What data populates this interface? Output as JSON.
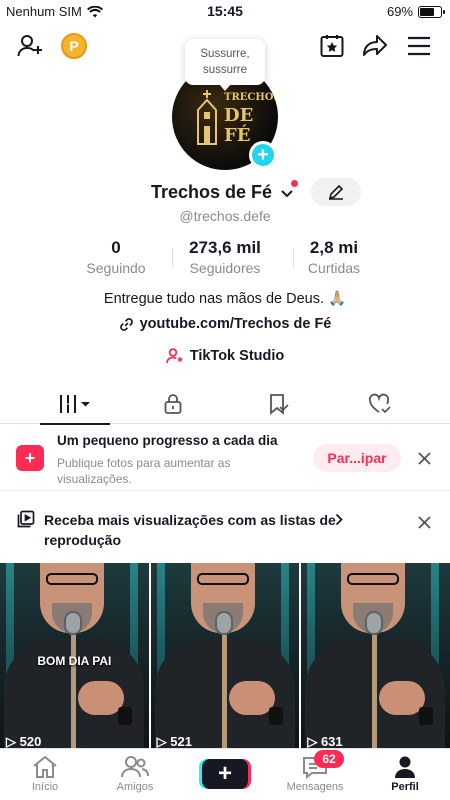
{
  "status_bar": {
    "carrier": "Nenhum SIM",
    "time": "15:45",
    "battery": "69%",
    "battery_level": 0.69
  },
  "top_bar": {
    "coin_label": "P",
    "icons": [
      "add-friend-icon",
      "coin-icon",
      "favorites-icon",
      "share-icon",
      "menu-icon"
    ]
  },
  "profile": {
    "tooltip": "Sussurre, sussurre",
    "avatar_text_small": "TRECHOS",
    "avatar_text_big": "DE FÉ",
    "name": "Trechos de Fé",
    "handle": "@trechos.defe",
    "stats": [
      {
        "value": "0",
        "label": "Seguindo"
      },
      {
        "value": "273,6 mil",
        "label": "Seguidores"
      },
      {
        "value": "2,8 mi",
        "label": "Curtidas"
      }
    ],
    "bio": "Entregue tudo nas mãos de Deus. 🙏🏼",
    "link": "youtube.com/Trechos de Fé",
    "studio": "TikTok Studio"
  },
  "tabs": [
    {
      "icon": "grid-icon",
      "active": true
    },
    {
      "icon": "lock-icon",
      "active": false
    },
    {
      "icon": "bookmark-icon",
      "active": false
    },
    {
      "icon": "liked-icon",
      "active": false
    }
  ],
  "banner_progress": {
    "title": "Um pequeno progresso a cada dia",
    "subtitle": "Publique fotos para aumentar as visualizações.",
    "button": "Par...ipar"
  },
  "banner_playlist": {
    "title": "Receba mais visualizações com as listas de reprodução"
  },
  "videos": [
    {
      "overlay": "BOM DIA PAI",
      "views": "520"
    },
    {
      "overlay": "",
      "views": "521"
    },
    {
      "overlay": "",
      "views": "631"
    }
  ],
  "nav": {
    "items": [
      {
        "label": "Início",
        "icon": "home-icon"
      },
      {
        "label": "Amigos",
        "icon": "friends-icon"
      },
      {
        "label": "",
        "icon": "create-icon"
      },
      {
        "label": "Mensagens",
        "icon": "inbox-icon"
      },
      {
        "label": "Perfil",
        "icon": "profile-icon"
      }
    ],
    "messages_badge": "62"
  },
  "colors": {
    "accent": "#fe2c55",
    "cyan": "#20d5ec",
    "text": "#161823",
    "muted": "#8a8b91"
  }
}
